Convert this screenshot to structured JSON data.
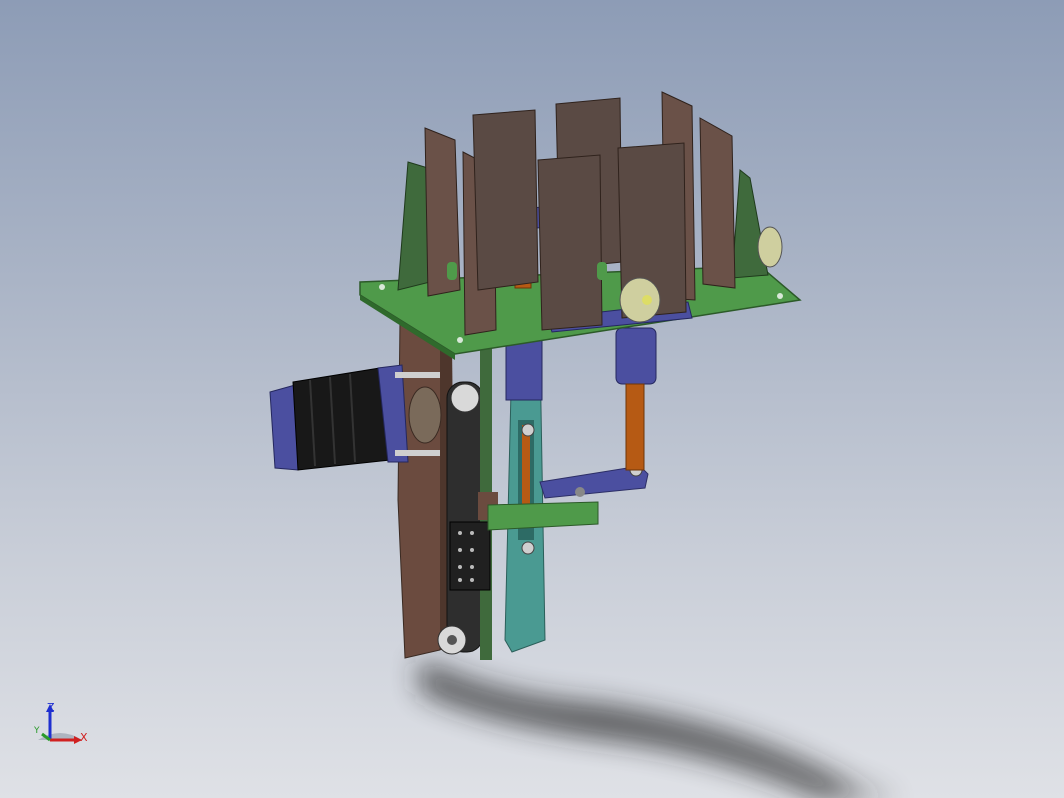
{
  "viewport": {
    "background_top": "#8d9cb6",
    "background_bottom": "#dfe1e6"
  },
  "model": {
    "colors": {
      "base_plate": "#4f9a4a",
      "divider_plates": "#6a5148",
      "motor_body": "#181818",
      "motor_flange": "#4b4fa0",
      "shafts": "#b65a14",
      "frame": "#6b4b3f",
      "slider": "#4a9a92",
      "arm": "#2e2e2e"
    }
  },
  "triad": {
    "z_label": "Z",
    "y_label": "Y",
    "x_label": "X",
    "z_color": "#1f2fd0",
    "y_color": "#2a9a2a",
    "x_color": "#d02020"
  }
}
